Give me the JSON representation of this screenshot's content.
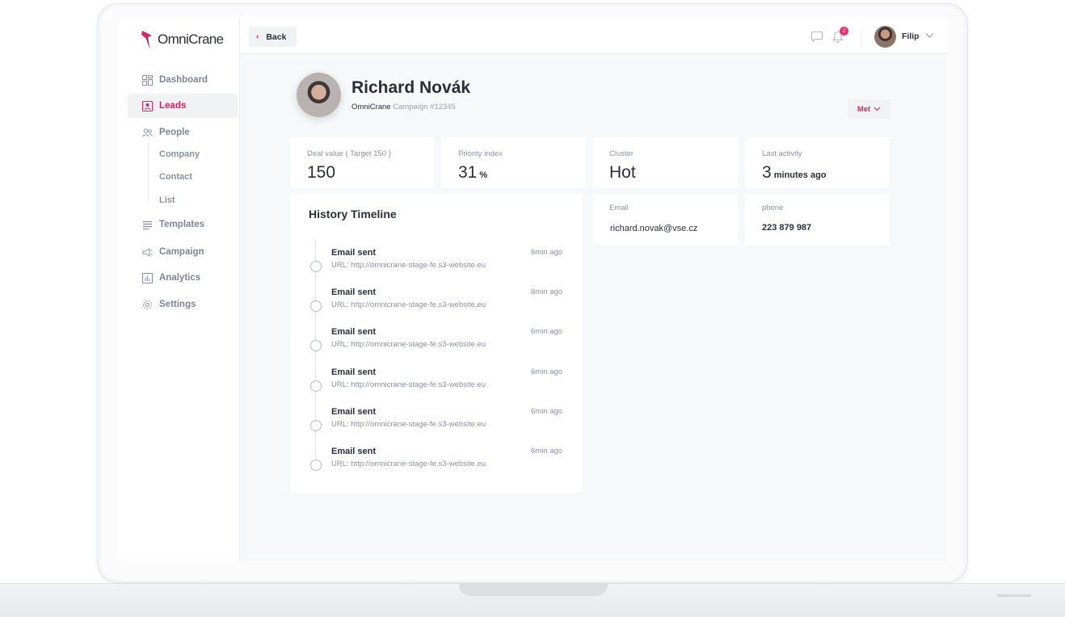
{
  "app": {
    "name": "OmniCrane"
  },
  "sidebar": {
    "items": [
      {
        "label": "Dashboard",
        "icon": "dashboard-icon"
      },
      {
        "label": "Leads",
        "icon": "leads-icon"
      },
      {
        "label": "People",
        "icon": "people-icon"
      },
      {
        "label": "Templates",
        "icon": "templates-icon"
      },
      {
        "label": "Campaign",
        "icon": "megaphone-icon"
      },
      {
        "label": "Analytics",
        "icon": "analytics-icon"
      },
      {
        "label": "Settings",
        "icon": "gear-icon"
      }
    ],
    "people_sub": [
      "Company",
      "Contact",
      "List"
    ],
    "active": "Leads"
  },
  "topbar": {
    "back_label": "Back",
    "notification_count": "2",
    "user_name": "Filip"
  },
  "lead": {
    "name": "Richard Novák",
    "company": "OmniCrane",
    "campaign": "Campaign #12345",
    "status": "Met"
  },
  "stats": [
    {
      "label": "Deal value ( Target 150 )",
      "value": "150",
      "unit": ""
    },
    {
      "label": "Priority index",
      "value": "31",
      "unit": " %"
    },
    {
      "label": "Cluster",
      "value": "Hot",
      "unit": ""
    },
    {
      "label": "Last activity",
      "value": "3",
      "unit": " minutes ago"
    }
  ],
  "contact": {
    "email_label": "Email",
    "email": "richard.novak@vse.cz",
    "phone_label": "phone",
    "phone": "223 879 987"
  },
  "timeline": {
    "title": "History Timeline",
    "items": [
      {
        "title": "Email sent",
        "url": "URL: http://omnicrane-stage-fe.s3-website.eu",
        "time": "6min ago"
      },
      {
        "title": "Email sent",
        "url": "URL: http://omnicrane-stage-fe.s3-website.eu",
        "time": "6min ago"
      },
      {
        "title": "Email sent",
        "url": "URL: http://omnicrane-stage-fe.s3-website.eu",
        "time": "6min ago"
      },
      {
        "title": "Email sent",
        "url": "URL: http://omnicrane-stage-fe.s3-website.eu",
        "time": "6min ago"
      },
      {
        "title": "Email sent",
        "url": "URL: http://omnicrane-stage-fe.s3-website.eu",
        "time": "6min ago"
      },
      {
        "title": "Email sent",
        "url": "URL: http://omnicrane-stage-fe.s3-website.eu",
        "time": "6min ago"
      }
    ]
  },
  "colors": {
    "accent": "#d9236b",
    "background": "#f7f8f9",
    "text": "#2b2e3a",
    "muted": "#8c91a0"
  }
}
